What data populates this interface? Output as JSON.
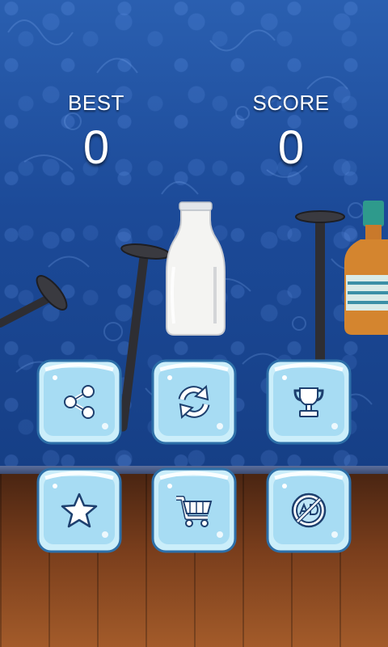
{
  "hud": {
    "best_label": "BEST",
    "best_value": "0",
    "score_label": "SCORE",
    "score_value": "0"
  },
  "menu": {
    "buttons": [
      {
        "id": "share",
        "icon": "share-icon"
      },
      {
        "id": "restart",
        "icon": "refresh-icon"
      },
      {
        "id": "leaderboard",
        "icon": "trophy-icon"
      },
      {
        "id": "rate",
        "icon": "star-icon"
      },
      {
        "id": "shop",
        "icon": "cart-icon"
      },
      {
        "id": "no-ads",
        "icon": "no-ads-icon"
      }
    ]
  },
  "colors": {
    "wall": "#1c4a98",
    "floor": "#7a3e1c",
    "ice": "#bfe6f7",
    "icon_fill": "#ffffff",
    "icon_outline": "#1d3f6e"
  }
}
